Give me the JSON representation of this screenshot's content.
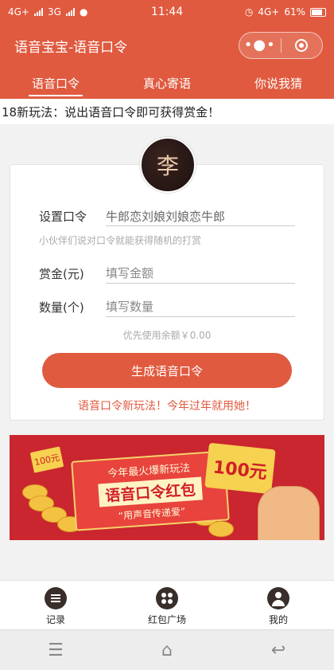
{
  "status_bar": {
    "left_network_1": "4G+",
    "left_network_2": "3G",
    "time": "11:44",
    "right_network": "4G+",
    "battery": "61%"
  },
  "header": {
    "title": "语音宝宝-语音口令",
    "more_icon": "more-dots-icon",
    "close_icon": "target-close-icon"
  },
  "tabs": [
    {
      "label": "语音口令",
      "active": true
    },
    {
      "label": "真心寄语",
      "active": false
    },
    {
      "label": "你说我猜",
      "active": false
    }
  ],
  "notice": "18新玩法：说出语音口令即可获得赏金！",
  "avatar": {
    "glyph": "李"
  },
  "form": {
    "password_label": "设置口令",
    "password_value": "牛郎恋刘娘刘娘恋牛郎",
    "password_hint": "小伙伴们说对口令就能获得随机的打赏",
    "amount_label": "赏金(元)",
    "amount_placeholder": "填写金额",
    "count_label": "数量(个)",
    "count_placeholder": "填写数量",
    "balance_text": "优先使用余额￥0.00",
    "submit_label": "生成语音口令",
    "slogan": "语音口令新玩法！今年过年就用她！"
  },
  "banner": {
    "line1": "今年最火爆新玩法",
    "line2": "语音口令红包",
    "line3": "“用声音传递爱”",
    "hongbao_text": "100元",
    "small_tag": "100元"
  },
  "bottom_nav": [
    {
      "label": "记录",
      "icon": "list-icon"
    },
    {
      "label": "红包广场",
      "icon": "grid-icon"
    },
    {
      "label": "我的",
      "icon": "user-icon"
    }
  ],
  "system_nav": {
    "menu_icon": "menu-icon",
    "home_icon": "home-icon",
    "back_icon": "back-icon"
  },
  "colors": {
    "primary": "#e05a3f",
    "banner_bg": "#c9262f",
    "background": "#f2f2f2"
  }
}
